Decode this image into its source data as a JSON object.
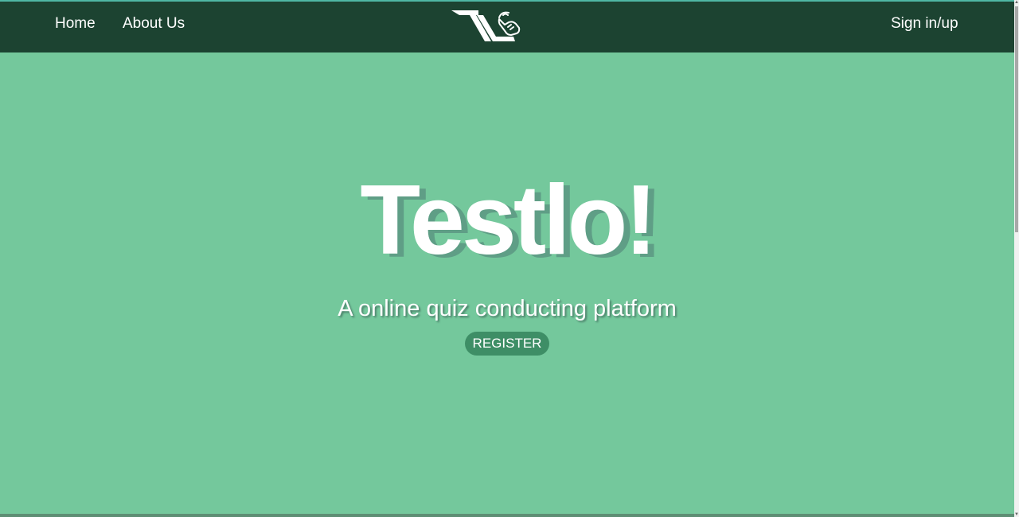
{
  "nav": {
    "home_label": "Home",
    "about_label": "About Us",
    "signin_label": "Sign in/up",
    "logo_icon": "testlo-logo-icon"
  },
  "hero": {
    "title": "Testlo!",
    "subtitle": "A online quiz conducting platform",
    "register_label": "REGISTER"
  },
  "colors": {
    "navbar_bg": "#1c4331",
    "hero_bg": "#74c89c",
    "button_bg": "#3e8e66",
    "text": "#ffffff"
  }
}
